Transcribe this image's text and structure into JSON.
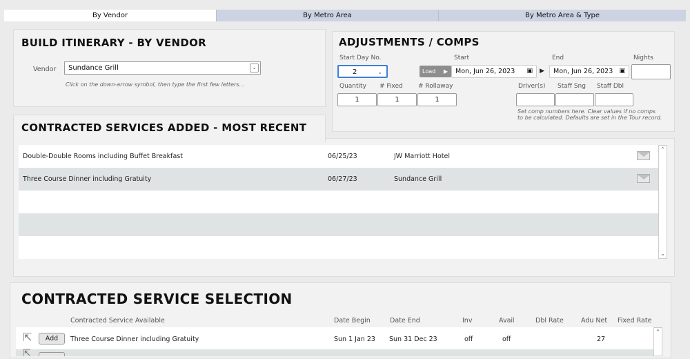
{
  "tabs": [
    "By Vendor",
    "By Metro Area",
    "By Metro Area & Type"
  ],
  "build": {
    "title": "BUILD ITINERARY - BY VENDOR",
    "vendor_label": "Vendor",
    "vendor_value": "Sundance Grill",
    "hint": "Click on the down-arrow symbol, then type the first few letters..."
  },
  "adjust": {
    "title": "ADJUSTMENTS / COMPS",
    "start_day_label": "Start Day No.",
    "start_day_value": "2",
    "load_label": "Load",
    "start_label": "Start",
    "start_value": "Mon, Jun 26, 2023",
    "end_label": "End",
    "end_value": "Mon, Jun 26, 2023",
    "nights_label": "Nights",
    "nights_value": "",
    "quantity_label": "Quantity",
    "quantity_value": "1",
    "fixed_label": "# Fixed",
    "fixed_value": "1",
    "rollaway_label": "# Rollaway",
    "rollaway_value": "1",
    "drivers_label": "Driver(s)",
    "staff_sng_label": "Staff Sng",
    "staff_dbl_label": "Staff Dbl",
    "comp_hint": "Set comp numbers here. Clear values if no comps to be calculated. Defaults are set in the Tour record."
  },
  "added": {
    "title": "CONTRACTED SERVICES ADDED - MOST RECENT",
    "rows": [
      {
        "service": "Double-Double Rooms including Buffet Breakfast",
        "date": "06/25/23",
        "vendor": "JW Marriott Hotel"
      },
      {
        "service": "Three Course Dinner including Gratuity",
        "date": "06/27/23",
        "vendor": "Sundance Grill"
      }
    ]
  },
  "selection": {
    "title": "CONTRACTED SERVICE SELECTION",
    "headers": {
      "service": "Contracted Service Available",
      "date_begin": "Date Begin",
      "date_end": "Date End",
      "inv": "Inv",
      "avail": "Avail",
      "dbl_rate": "Dbl Rate",
      "adu_net": "Adu Net",
      "fixed_rate": "Fixed Rate"
    },
    "add_label": "Add",
    "rows": [
      {
        "service": "Three Course Dinner including Gratuity",
        "date_begin": "Sun 1 Jan 23",
        "date_end": "Sun 31 Dec 23",
        "inv": "off",
        "avail": "off",
        "dbl_rate": "",
        "adu_net": "27",
        "fixed_rate": ""
      }
    ]
  }
}
